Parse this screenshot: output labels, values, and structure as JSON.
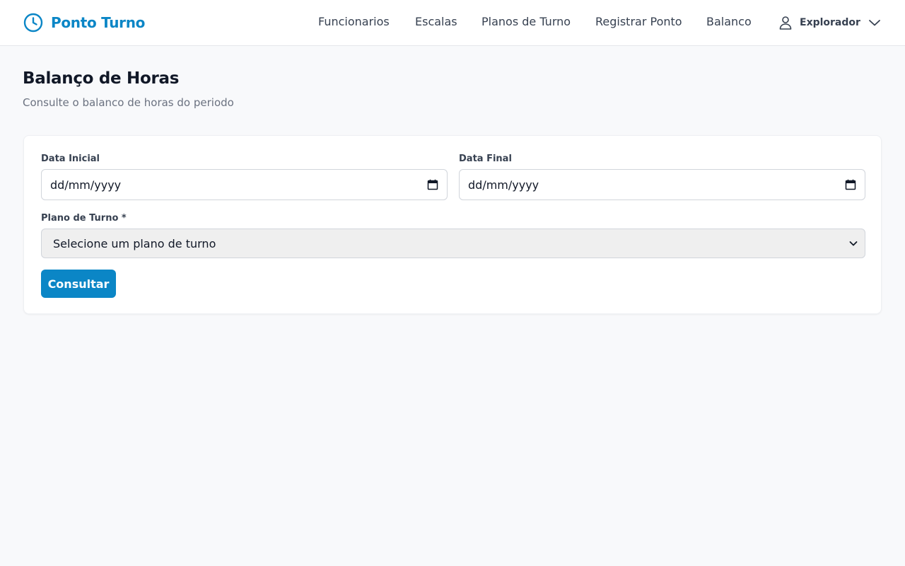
{
  "app": {
    "brand": "Ponto Turno",
    "brand_icon": "clock-icon"
  },
  "nav": {
    "items": [
      {
        "label": "Funcionarios"
      },
      {
        "label": "Escalas"
      },
      {
        "label": "Planos de Turno"
      },
      {
        "label": "Registrar Ponto"
      },
      {
        "label": "Balanco"
      }
    ]
  },
  "user": {
    "name": "Explorador",
    "icon": "user-icon",
    "menu_icon": "chevron-down-icon"
  },
  "page": {
    "title": "Balanço de Horas",
    "subtitle": "Consulte o balanco de horas do periodo"
  },
  "form": {
    "start_date": {
      "label": "Data Inicial",
      "value": "dd/mm/yyyy",
      "icon": "calendar-icon"
    },
    "end_date": {
      "label": "Data Final",
      "value": "dd/mm/yyyy",
      "icon": "calendar-icon"
    },
    "shift_plan": {
      "label": "Plano de Turno *",
      "value": "Selecione um plano de turno",
      "icon": "chevron-down-icon"
    },
    "submit_label": "Consultar"
  },
  "colors": {
    "brand": "#0b86c6",
    "background": "#f8f9fb",
    "card": "#ffffff"
  }
}
